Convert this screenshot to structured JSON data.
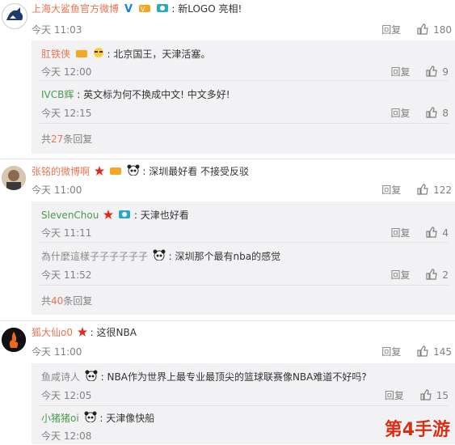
{
  "threads": [
    {
      "user": "上海大鲨鱼官方微博",
      "text": "新LOGO 亮相!",
      "time": "今天 11:03",
      "reply": "回复",
      "likes": "180",
      "subs": [
        {
          "user": "肛铁侠",
          "text": "北京国王，天津活塞。",
          "time": "今天 12:00",
          "reply": "回复",
          "likes": "9"
        },
        {
          "user": "IVCB辉",
          "text": "英文标为何不换成中文! 中文多好!",
          "time": "今天 12:15",
          "reply": "回复",
          "likes": "8"
        }
      ],
      "more_prefix": "共",
      "more_num": "27",
      "more_suffix": "条回复"
    },
    {
      "user": "张铭的微博啊",
      "text": "深圳最好看 不接受反驳",
      "time": "今天 11:00",
      "reply": "回复",
      "likes": "122",
      "subs": [
        {
          "user": "SlevenChou",
          "text": "天津也好看",
          "time": "今天 11:11",
          "reply": "回复",
          "likes": "4"
        },
        {
          "user": "為什麼這樣子子子子子子",
          "text": "深圳那个最有nba的感觉",
          "time": "今天 11:52",
          "reply": "回复",
          "likes": "2"
        }
      ],
      "more_prefix": "共",
      "more_num": "40",
      "more_suffix": "条回复"
    },
    {
      "user": "狐大仙o0",
      "text": "这很NBA",
      "time": "今天 11:00",
      "reply": "回复",
      "likes": "145",
      "subs": [
        {
          "user": "鱼咸诗人",
          "text": "NBA作为世界上最专业最顶尖的篮球联赛像NBA难道不好吗?",
          "time": "今天 12:05",
          "reply": "回复",
          "likes": "15"
        },
        {
          "user": "小猪猪oi",
          "text": "天津像快船",
          "time": "今天 12:08",
          "reply": "",
          "likes": ""
        }
      ]
    }
  ],
  "watermark": "第4手游",
  "colors": {
    "name": "#eb7350",
    "sub_bg": "#f2f2f5",
    "time": "#808080"
  }
}
